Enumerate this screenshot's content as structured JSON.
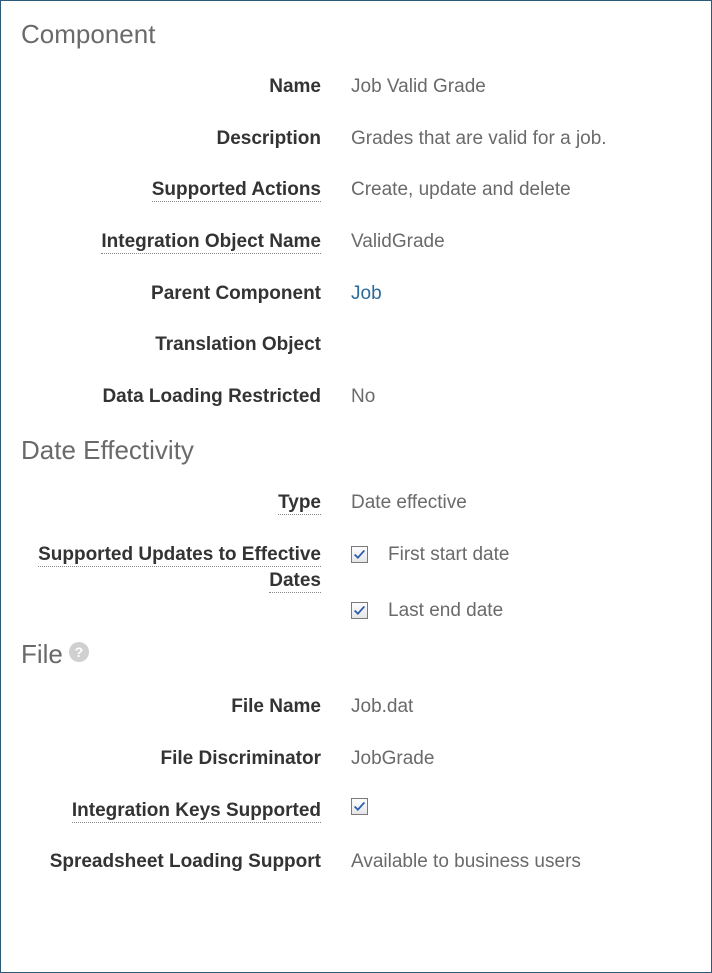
{
  "sections": {
    "component": {
      "title": "Component",
      "fields": {
        "name": {
          "label": "Name",
          "value": "Job Valid Grade"
        },
        "description": {
          "label": "Description",
          "value": "Grades that are valid for a job."
        },
        "supportedActions": {
          "label": "Supported Actions",
          "value": "Create, update and delete"
        },
        "integrationObjectName": {
          "label": "Integration Object Name",
          "value": "ValidGrade"
        },
        "parentComponent": {
          "label": "Parent Component",
          "value": "Job"
        },
        "translationObject": {
          "label": "Translation Object",
          "value": ""
        },
        "dataLoadingRestricted": {
          "label": "Data Loading Restricted",
          "value": "No"
        }
      }
    },
    "dateEffectivity": {
      "title": "Date Effectivity",
      "fields": {
        "type": {
          "label": "Type",
          "value": "Date effective"
        },
        "supportedUpdates": {
          "label": "Supported Updates to Effective Dates",
          "options": {
            "firstStart": {
              "label": "First start date",
              "checked": true
            },
            "lastEnd": {
              "label": "Last end date",
              "checked": true
            }
          }
        }
      }
    },
    "file": {
      "title": "File",
      "fields": {
        "fileName": {
          "label": "File Name",
          "value": "Job.dat"
        },
        "fileDiscriminator": {
          "label": "File Discriminator",
          "value": "JobGrade"
        },
        "integrationKeysSupported": {
          "label": "Integration Keys Supported",
          "checked": true
        },
        "spreadsheetLoadingSupport": {
          "label": "Spreadsheet Loading Support",
          "value": "Available to business users"
        }
      }
    }
  }
}
